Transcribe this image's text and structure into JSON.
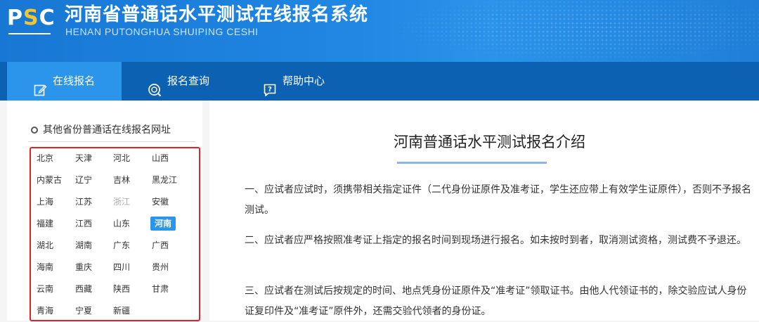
{
  "header": {
    "logo_text_p": "P",
    "logo_text_s": "S",
    "logo_text_c": "C",
    "title": "河南省普通话水平测试在线报名系统",
    "subtitle": "HENAN PUTONGHUA SHUIPING CESHI"
  },
  "nav": {
    "tabs": [
      {
        "label": "在线报名",
        "icon": "edit-icon",
        "active": true
      },
      {
        "label": "报名查询",
        "icon": "search-icon",
        "active": false
      },
      {
        "label": "帮助中心",
        "icon": "help-icon",
        "active": false
      }
    ]
  },
  "sidebar": {
    "title": "其他省份普通话在线报名网址",
    "provinces": [
      [
        "北京",
        "天津",
        "河北",
        "山西"
      ],
      [
        "内蒙古",
        "辽宁",
        "吉林",
        "黑龙江"
      ],
      [
        "上海",
        "江苏",
        "浙江",
        "安徽"
      ],
      [
        "福建",
        "江西",
        "山东",
        "河南"
      ],
      [
        "湖北",
        "湖南",
        "广东",
        "广西"
      ],
      [
        "海南",
        "重庆",
        "四川",
        "贵州"
      ],
      [
        "云南",
        "西藏",
        "陕西",
        "甘肃"
      ],
      [
        "青海",
        "宁夏",
        "新疆"
      ]
    ],
    "active_province": "河南",
    "disabled_province": "浙江"
  },
  "main": {
    "title": "河南普通话水平测试报名介绍",
    "paragraphs": [
      "一、应试者应试时，须携带相关指定证件（二代身份证原件及准考证，学生还应带上有效学生证原件），否则不予报名测试。",
      "二、应试者应严格按照准考证上指定的报名时间到现场进行报名。如未按时到者，取消测试资格，测试费不予退还。",
      "三、应试者在测试后按规定的时间、地点凭身份证原件及“准考证”领取证书。由他人代领证书的，除交验应试人身份证复印件及“准考证”原件外，还需交验代领者的身份证。"
    ]
  },
  "colors": {
    "header_blue": "#1f86e2",
    "nav_blue": "#0d61b3",
    "active_tab": "#2a95ea",
    "highlight_red": "#e2232a",
    "logo_yellow": "#f4c62a"
  }
}
